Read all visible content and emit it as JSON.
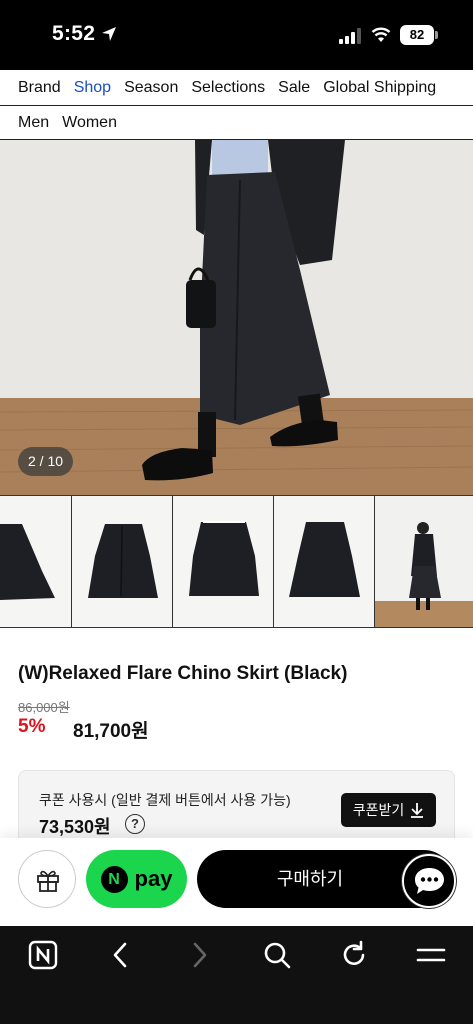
{
  "status_bar": {
    "time": "5:52",
    "battery": "82"
  },
  "nav": {
    "items": [
      "Brand",
      "Shop",
      "Season",
      "Selections",
      "Sale",
      "Global Shipping"
    ],
    "active": "Shop",
    "sub_items": [
      "Men",
      "Women"
    ]
  },
  "gallery": {
    "counter": "2 / 10"
  },
  "product": {
    "title": "(W)Relaxed Flare Chino Skirt (Black)",
    "original_price": "86,000원",
    "discount_rate": "5%",
    "sale_price": "81,700원"
  },
  "coupon": {
    "description": "쿠폰 사용시 (일반 결제 버튼에서 사용 가능)",
    "price": "73,530원",
    "help": "?",
    "button_label": "쿠폰받기"
  },
  "actions": {
    "npay_logo": "N",
    "npay_label": "pay",
    "buy_label": "구매하기"
  },
  "browser_bar": {
    "icons": [
      "naver-home-icon",
      "back-icon",
      "forward-icon",
      "search-icon",
      "refresh-icon",
      "menu-icon"
    ],
    "home_glyph": "N"
  },
  "colors": {
    "active_nav": "#1a4fbd",
    "discount": "#e0121b",
    "npay": "#1bd64d",
    "primary_dark": "#000000"
  }
}
